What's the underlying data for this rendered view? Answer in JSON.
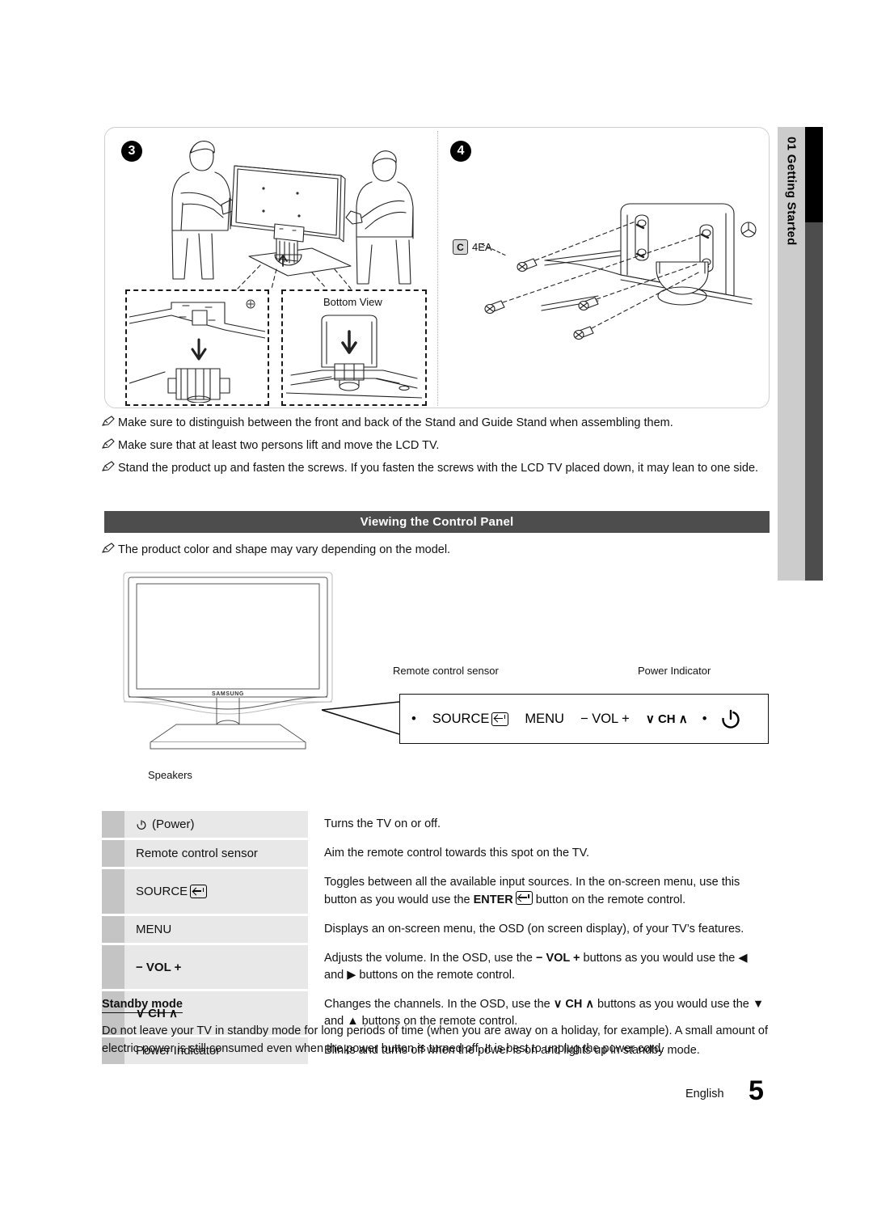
{
  "sidebar": {
    "chapter_number": "01",
    "chapter_title": "Getting Started",
    "vertical_label": "01  Getting Started"
  },
  "assembly": {
    "step3": {
      "badge": "3",
      "detail_label_right": "Bottom View",
      "detail_label_left": ""
    },
    "step4": {
      "badge": "4",
      "part_letter": "C",
      "part_qty": "4EA"
    }
  },
  "notes": [
    "Make sure to distinguish between the front and back of the Stand and Guide Stand when assembling them.",
    "Make sure that at least two persons lift and move the LCD TV.",
    "Stand the product up and fasten the screws. If you fasten the screws with the LCD TV placed down, it may lean to one side."
  ],
  "section": {
    "title": "Viewing the Control Panel",
    "note": "The product color and shape may vary depending on the model."
  },
  "illustration": {
    "brand": "SAMSUNG",
    "speakers_label": "Speakers",
    "remote_sensor_label": "Remote control sensor",
    "power_indicator_label": "Power Indicator",
    "panel_buttons": [
      {
        "type": "dot",
        "text": "•"
      },
      {
        "type": "text",
        "text": "SOURCE",
        "glyph": "enter-icon"
      },
      {
        "type": "text",
        "text": "MENU"
      },
      {
        "type": "text",
        "text": "− VOL +"
      },
      {
        "type": "text",
        "text": "∨ CH ∧"
      },
      {
        "type": "dot",
        "text": "•"
      },
      {
        "type": "icon",
        "text": "power-icon"
      }
    ]
  },
  "table": {
    "rows": [
      {
        "label": "(Power)",
        "label_icon": "power-icon",
        "bold": false,
        "desc": "Turns the TV on or off."
      },
      {
        "label": "Remote control sensor",
        "bold": false,
        "desc": "Aim the remote control towards this spot on the TV."
      },
      {
        "label": "SOURCE",
        "label_icon": "enter-icon",
        "bold": false,
        "desc_pre": "Toggles between all the available input sources. In the on-screen menu, use this button as you would use the ",
        "desc_strong": "ENTER",
        "desc_post": " button on the remote control.",
        "desc": "Toggles between all the available input sources. In the on-screen menu, use this button as you would use the ENTER button on the remote control."
      },
      {
        "label": "MENU",
        "bold": false,
        "desc": "Displays an on-screen menu, the OSD (on screen display), of your TV’s features."
      },
      {
        "label": "− VOL +",
        "bold": true,
        "desc_pre": "Adjusts the volume. In the OSD, use the ",
        "desc_strong": "− VOL +",
        "desc_post": " buttons as you would use the ◀ and ▶ buttons on the remote control.",
        "desc": "Adjusts the volume. In the OSD, use the − VOL + buttons as you would use the ◀ and ▶ buttons on the remote control."
      },
      {
        "label": "∨ CH ∧",
        "bold": true,
        "desc_pre": "Changes the channels. In the OSD, use the ",
        "desc_strong": "∨ CH ∧",
        "desc_post": " buttons as you would use the ▼ and ▲ buttons on the remote control.",
        "desc": "Changes the channels. In the OSD, use the ∨ CH ∧ buttons as you would use the ▼ and ▲ buttons on the remote control."
      },
      {
        "label": "Power Indicator",
        "bold": false,
        "desc": "Blinks and turns off when the power is on and lights up in standby mode."
      }
    ]
  },
  "standby": {
    "heading": "Standby mode",
    "body": "Do not leave your TV in standby mode for long periods of time (when you are away on a holiday, for example). A small amount of electric power is still consumed even when the power button is turned off. It is best to unplug the power cord."
  },
  "footer": {
    "language": "English",
    "page_number": "5"
  },
  "colors": {
    "section_bar": "#4d4d4d",
    "sidebar_light": "#cccccc",
    "sidebar_black": "#000000",
    "sidebar_gray": "#4d4d4d",
    "table_stripe": "#c4c4c4",
    "table_label": "#e8e8e8"
  }
}
